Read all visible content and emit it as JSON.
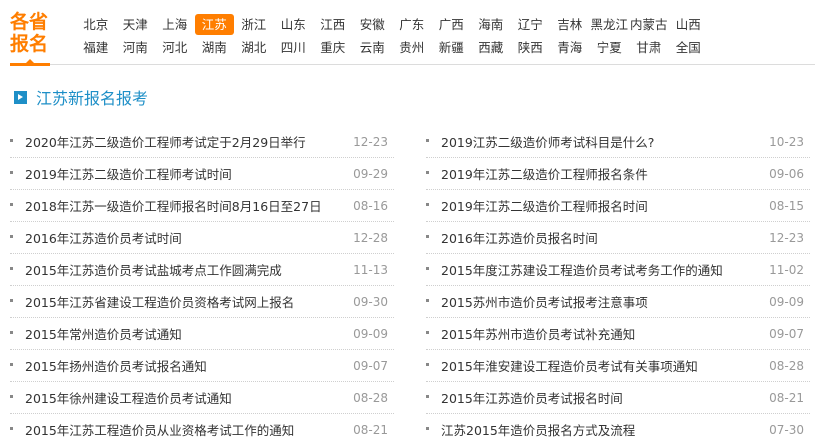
{
  "nav": {
    "title_line1": "各省",
    "title_line2": "报名",
    "row1": [
      "北京",
      "天津",
      "上海",
      "江苏",
      "浙江",
      "山东",
      "江西",
      "安徽",
      "广东",
      "广西",
      "海南",
      "辽宁",
      "吉林",
      "黑龙江",
      "内蒙古",
      "山西"
    ],
    "row2": [
      "福建",
      "河南",
      "河北",
      "湖南",
      "湖北",
      "四川",
      "重庆",
      "云南",
      "贵州",
      "新疆",
      "西藏",
      "陕西",
      "青海",
      "宁夏",
      "甘肃",
      "全国"
    ],
    "active": "江苏"
  },
  "section": {
    "title": "江苏新报名报考"
  },
  "left_list": [
    {
      "title": "2020年江苏二级造价工程师考试定于2月29日举行",
      "date": "12-23"
    },
    {
      "title": "2019年江苏二级造价工程师考试时间",
      "date": "09-29"
    },
    {
      "title": "2018年江苏一级造价工程师报名时间8月16日至27日",
      "date": "08-16"
    },
    {
      "title": "2016年江苏造价员考试时间",
      "date": "12-28"
    },
    {
      "title": "2015年江苏造价员考试盐城考点工作圆满完成",
      "date": "11-13"
    },
    {
      "title": "2015年江苏省建设工程造价员资格考试网上报名",
      "date": "09-30"
    },
    {
      "title": "2015年常州造价员考试通知",
      "date": "09-09"
    },
    {
      "title": "2015年扬州造价员考试报名通知",
      "date": "09-07"
    },
    {
      "title": "2015年徐州建设工程造价员考试通知",
      "date": "08-28"
    },
    {
      "title": "2015年江苏工程造价员从业资格考试工作的通知",
      "date": "08-21"
    }
  ],
  "right_list": [
    {
      "title": "2019江苏二级造价师考试科目是什么?",
      "date": "10-23"
    },
    {
      "title": "2019年江苏二级造价工程师报名条件",
      "date": "09-06"
    },
    {
      "title": "2019年江苏二级造价工程师报名时间",
      "date": "08-15"
    },
    {
      "title": "2016年江苏造价员报名时间",
      "date": "12-23"
    },
    {
      "title": "2015年度江苏建设工程造价员考试考务工作的通知",
      "date": "11-02"
    },
    {
      "title": "2015苏州市造价员考试报考注意事项",
      "date": "09-09"
    },
    {
      "title": "2015年苏州市造价员考试补充通知",
      "date": "09-07"
    },
    {
      "title": "2015年淮安建设工程造价员考试有关事项通知",
      "date": "08-28"
    },
    {
      "title": "2015年江苏造价员考试报名时间",
      "date": "08-21"
    },
    {
      "title": "江苏2015年造价员报名方式及流程",
      "date": "07-30"
    }
  ],
  "colors": {
    "accent": "#ff7e00",
    "section_blue": "#1e8fc7"
  }
}
